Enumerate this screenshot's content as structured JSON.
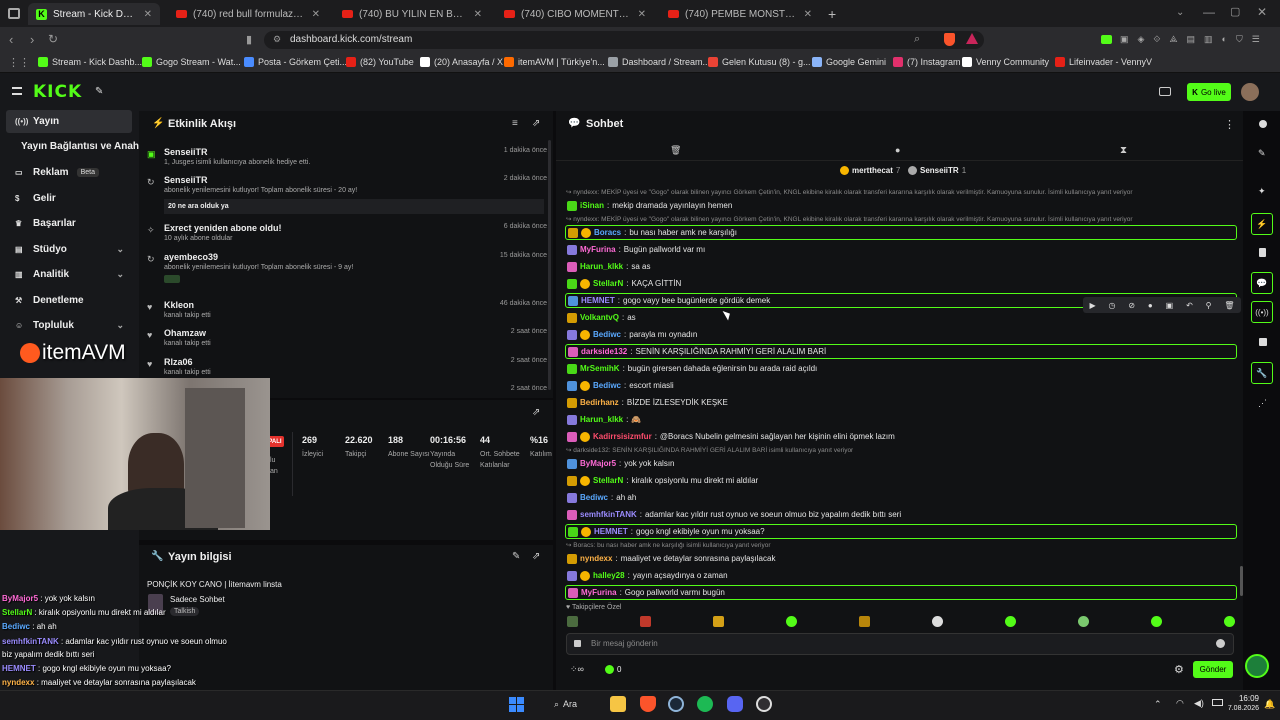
{
  "browser": {
    "tabs": [
      {
        "label": "Stream - Kick Dashboard",
        "active": true,
        "icon": "kick-icon"
      },
      {
        "label": "(740) red bull formulaz + rize vlog -",
        "icon": "youtube-icon"
      },
      {
        "label": "(740) BU YILIN EN BÜYÜK DRAMASI",
        "icon": "youtube-icon"
      },
      {
        "label": "(740) CİBO MOMENTS | ULTRA HIZLI",
        "icon": "youtube-icon"
      },
      {
        "label": "(740) PEMBE MONSTER | Madara Olı",
        "icon": "youtube-icon"
      }
    ],
    "url": "dashboard.kick.com/stream",
    "bookmarks": [
      {
        "label": "Stream - Kick Dashb...",
        "color": "#53fc18"
      },
      {
        "label": "Gogo Stream - Wat...",
        "color": "#53fc18"
      },
      {
        "label": "Posta - Görkem Çeti...",
        "color": "#4a8cff"
      },
      {
        "label": "(82) YouTube",
        "color": "#e62117"
      },
      {
        "label": "(20) Anasayfa / X",
        "color": "#ffffff"
      },
      {
        "label": "itemAVM | Türkiye'n...",
        "color": "#ff6a00"
      },
      {
        "label": "Dashboard / Stream...",
        "color": "#9aa0a6"
      },
      {
        "label": "Gelen Kutusu (8) - g...",
        "color": "#ea4335"
      },
      {
        "label": "Google Gemini",
        "color": "#8ab4f8"
      },
      {
        "label": "(7) Instagram",
        "color": "#e1306c"
      },
      {
        "label": "Venny Community",
        "color": "#ffffff"
      },
      {
        "label": "Lifeinvader - VennyV",
        "color": "#e62117"
      }
    ]
  },
  "kick": {
    "logo": "KICK",
    "go_live": "Go live"
  },
  "sidebar": {
    "items": [
      {
        "label": "Yayın",
        "icon": "broadcast-icon",
        "selected": true
      },
      {
        "label": "Yayın Bağlantısı ve Anahtarı",
        "icon": ""
      },
      {
        "label": "Reklam",
        "icon": "ad-icon",
        "badge": "Beta"
      },
      {
        "label": "Gelir",
        "icon": "dollar-icon"
      },
      {
        "label": "Başarılar",
        "icon": "trophy-icon"
      },
      {
        "label": "Stüdyo",
        "icon": "studio-icon",
        "expand": true
      },
      {
        "label": "Analitik",
        "icon": "analytics-icon",
        "expand": true
      },
      {
        "label": "Denetleme",
        "icon": "hammer-icon"
      },
      {
        "label": "Topluluk",
        "icon": "community-icon",
        "expand": true
      }
    ]
  },
  "activity": {
    "title": "Etkinlik Akışı",
    "items": [
      {
        "name": "SenseiiTR",
        "sub": "1, Jusges isimli kullanıcıya abonelik hediye etti.",
        "time": "1 dakika önce"
      },
      {
        "name": "SenseiiTR",
        "sub": "abonelik yenilemesini kutluyor! Toplam abonelik süresi - 20 ay!",
        "note": "20 ne ara olduk ya",
        "time": "2 dakika önce"
      },
      {
        "name": "Exrect yeniden abone oldu!",
        "sub": "10 aylık abone oldular",
        "time": "6 dakika önce"
      },
      {
        "name": "ayembeco39",
        "sub": "abonelik yenilemesini kutluyor! Toplam abonelik süresi - 9 ay!",
        "time": "15 dakika önce"
      },
      {
        "name": "Kkleon",
        "sub": "kanalı takip etti",
        "time": "46 dakika önce"
      },
      {
        "name": "Ohamzaw",
        "sub": "kanalı takip etti",
        "time": "2 saat önce"
      },
      {
        "name": "Rlza06",
        "sub": "kanalı takip etti",
        "time": "2 saat önce"
      },
      {
        "name": "",
        "sub": "",
        "time": "2 saat önce"
      }
    ]
  },
  "stats": [
    {
      "value": "269",
      "label": "İzleyici"
    },
    {
      "value": "22.620",
      "label": "Takipçi"
    },
    {
      "value": "188",
      "label": "Abone Sayısı"
    },
    {
      "value": "00:16:56",
      "label": "Yayında Olduğu Süre"
    },
    {
      "value": "44",
      "label": "Ort. Sohbete Katılanlar"
    },
    {
      "value": "%16",
      "label": "Katılım"
    }
  ],
  "stats_partial": {
    "live": "PALI",
    "lbl": "lu\nan"
  },
  "stream_info": {
    "title": "Yayın bilgisi",
    "stream_title": "PONÇİK KOY CANO | İitemavm linsta",
    "mode": "Sadece Sohbet",
    "category": "Talkish"
  },
  "chat": {
    "title": "Sohbet",
    "top_users": [
      {
        "name": "mertthecat",
        "count": "7"
      },
      {
        "name": "SenseiiTR",
        "count": "1"
      }
    ],
    "lines": [
      {
        "reply": "nyndexx: MEKİP üyesi ve \"Gogo\" olarak bilinen yayıncı Görkem Çetin'in, KNGL ekibine kiralık olarak transferi kararına karşılık olarak verilmiştir. Kamuoyuna sunulur. İsimli kullanıcıya yanıt veriyor"
      },
      {
        "user": "iSinan",
        "color": "#53fc18",
        "text": "mekip dramada yayınlayın hemen"
      },
      {
        "reply": "nyndexx: MEKİP üyesi ve \"Gogo\" olarak bilinen yayıncı Görkem Çetin'in, KNGL ekibine kiralık olarak transferi kararına karşılık olarak verilmiştir. Kamuoyuna sunulur. İsimli kullanıcıya yanıt veriyor"
      },
      {
        "user": "Boracs",
        "color": "#5aa9ff",
        "text": "bu nası haber amk ne karşılığı",
        "hl": true
      },
      {
        "user": "MyFurina",
        "color": "#ff6bd6",
        "text": "Bugün pallworld var mı"
      },
      {
        "user": "Harun_klkk",
        "color": "#53fc18",
        "text": "sa as"
      },
      {
        "user": "StellarN",
        "color": "#53fc18",
        "text": "KAÇA GİTTİN"
      },
      {
        "user": "HEMNET",
        "color": "#9b8cff",
        "text": "gogo vayy bee bugünlerde gördük demek",
        "hl": true
      },
      {
        "user": "VolkantvQ",
        "color": "#53fc18",
        "text": "as"
      },
      {
        "user": "Bediwc",
        "color": "#5aa9ff",
        "text": "parayla mı oynadın"
      },
      {
        "user": "darkside132",
        "color": "#ff6bd6",
        "text": "SENİN KARŞILIĞINDA RAHMİYİ GERİ ALALIM BARİ",
        "hl": true
      },
      {
        "user": "MrSemihK",
        "color": "#53fc18",
        "text": "bugün girersen dahada eğlenirsin bu arada raid açıldı"
      },
      {
        "user": "Bediwc",
        "color": "#5aa9ff",
        "text": "escort miasli"
      },
      {
        "user": "Bedirhanz",
        "color": "#ffb347",
        "text": "BİZDE İZLESEYDİK KEŞKE"
      },
      {
        "user": "Harun_klkk",
        "color": "#53fc18",
        "text": "🙈"
      },
      {
        "user": "Kadirrsisizmfur",
        "color": "#ff4d6d",
        "text": "@Boracs Nubelin gelmesini sağlayan her kişinin elini öpmek lazım"
      },
      {
        "reply": "darkside132: SENİN KARŞILIĞINDA RAHMİYİ GERİ ALALIM BARİ isimli kullanıcıya yanıt veriyor"
      },
      {
        "user": "ByMajor5",
        "color": "#ff6bd6",
        "text": "yok yok kalsın"
      },
      {
        "user": "StellarN",
        "color": "#53fc18",
        "text": "kiralık opsiyonlu mu direkt mi aldılar"
      },
      {
        "user": "Bediwc",
        "color": "#5aa9ff",
        "text": "ah ah"
      },
      {
        "user": "semhfkinTANK",
        "color": "#9b8cff",
        "text": "adamlar kac yıldır rust oynuo ve soeun olmuo biz yapalım dedik bıttı seri"
      },
      {
        "user": "HEMNET",
        "color": "#9b8cff",
        "text": "gogo kngl ekibiyle oyun mu yoksaa?",
        "hl": true
      },
      {
        "reply": "Boracs: bu nası haber amk ne karşılığı isimli kullanıcıya yanıt veriyor"
      },
      {
        "user": "nyndexx",
        "color": "#ffb347",
        "text": "maaliyet ve detaylar sonrasına paylaşılacak"
      },
      {
        "user": "halley28",
        "color": "#53fc18",
        "text": "yayın açsaydınya o zaman"
      },
      {
        "user": "MyFurina",
        "color": "#ff6bd6",
        "text": "Gogo pallworld varmı bugün",
        "hl": true
      }
    ],
    "subs_only": "Takipçilere Özel",
    "placeholder": "Bir mesaj gönderin",
    "send": "Gönder",
    "points": "0"
  },
  "overlay": {
    "brand": "itemAVM",
    "lines": [
      {
        "user": "ByMajor5",
        "color": "#ff6bd6",
        "text": "yok yok kalsın"
      },
      {
        "user": "StellarN",
        "color": "#53fc18",
        "text": "kiralık opsiyonlu mu direkt mi aldılar"
      },
      {
        "user": "Bediwc",
        "color": "#5aa9ff",
        "text": "ah ah"
      },
      {
        "user": "semhfkinTANK",
        "color": "#9b8cff",
        "text": "adamlar kac yıldır rust oynuo ve soeun olmuo"
      },
      {
        "user": "",
        "color": "#fff",
        "text": "biz yapalım dedik bıttı seri"
      },
      {
        "user": "HEMNET",
        "color": "#9b8cff",
        "text": "gogo kngl ekibiyle oyun mu yoksaa?"
      },
      {
        "user": "nyndexx",
        "color": "#ffb347",
        "text": "maaliyet ve detaylar sonrasına paylaşılacak"
      },
      {
        "user": "halley28",
        "color": "#fff",
        "text": "yayın açsaydınya o zaman"
      },
      {
        "user": "MyFurina",
        "color": "#ff6bd6",
        "text": "Gogo pallworld varmı bugün"
      }
    ]
  },
  "taskbar": {
    "search": "Ara",
    "time": "16:09",
    "date": "7.08.2026"
  }
}
